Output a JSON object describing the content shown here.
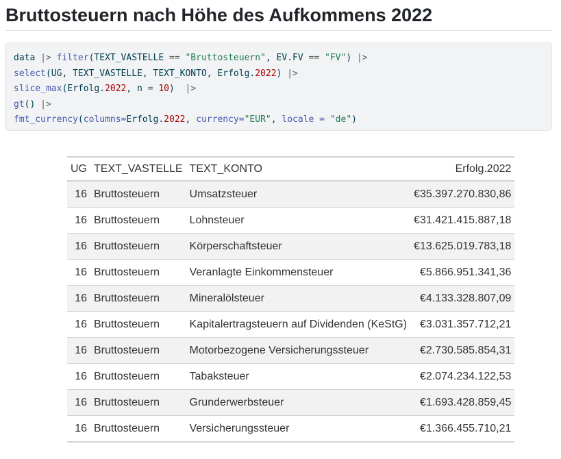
{
  "page": {
    "title": "Bruttosteuern nach Höhe des Aufkommens 2022"
  },
  "code": {
    "lines": [
      [
        {
          "t": "data ",
          "c": "plain"
        },
        {
          "t": "|>",
          "c": "op"
        },
        {
          "t": " ",
          "c": "plain"
        },
        {
          "t": "filter",
          "c": "fn"
        },
        {
          "t": "(TEXT_VASTELLE ",
          "c": "plain"
        },
        {
          "t": "==",
          "c": "op"
        },
        {
          "t": " ",
          "c": "plain"
        },
        {
          "t": "\"Bruttosteuern\"",
          "c": "str"
        },
        {
          "t": ", EV.FV ",
          "c": "plain"
        },
        {
          "t": "==",
          "c": "op"
        },
        {
          "t": " ",
          "c": "plain"
        },
        {
          "t": "\"FV\"",
          "c": "str"
        },
        {
          "t": ") ",
          "c": "plain"
        },
        {
          "t": "|>",
          "c": "op"
        }
      ],
      [
        {
          "t": "select",
          "c": "fn"
        },
        {
          "t": "(UG, TEXT_VASTELLE, TEXT_KONTO, Erfolg.",
          "c": "plain"
        },
        {
          "t": "2022",
          "c": "num"
        },
        {
          "t": ") ",
          "c": "plain"
        },
        {
          "t": "|>",
          "c": "op"
        }
      ],
      [
        {
          "t": "slice_max",
          "c": "fn"
        },
        {
          "t": "(Erfolg.",
          "c": "plain"
        },
        {
          "t": "2022",
          "c": "num"
        },
        {
          "t": ", n ",
          "c": "plain"
        },
        {
          "t": "=",
          "c": "op"
        },
        {
          "t": " ",
          "c": "plain"
        },
        {
          "t": "10",
          "c": "num"
        },
        {
          "t": ")  ",
          "c": "plain"
        },
        {
          "t": "|>",
          "c": "op"
        }
      ],
      [
        {
          "t": "gt",
          "c": "fn"
        },
        {
          "t": "() ",
          "c": "plain"
        },
        {
          "t": "|>",
          "c": "op"
        }
      ],
      [
        {
          "t": "fmt_currency",
          "c": "fn"
        },
        {
          "t": "(",
          "c": "plain"
        },
        {
          "t": "columns=",
          "c": "fn"
        },
        {
          "t": "Erfolg.",
          "c": "plain"
        },
        {
          "t": "2022",
          "c": "num"
        },
        {
          "t": ", ",
          "c": "plain"
        },
        {
          "t": "currency=",
          "c": "fn"
        },
        {
          "t": "\"EUR\"",
          "c": "str"
        },
        {
          "t": ", ",
          "c": "plain"
        },
        {
          "t": "locale =",
          "c": "fn"
        },
        {
          "t": " ",
          "c": "plain"
        },
        {
          "t": "\"de\"",
          "c": "str"
        },
        {
          "t": ")",
          "c": "plain"
        }
      ]
    ]
  },
  "table": {
    "headers": {
      "ug": "UG",
      "vastelle": "TEXT_VASTELLE",
      "konto": "TEXT_KONTO",
      "erfolg": "Erfolg.2022"
    },
    "rows": [
      {
        "ug": "16",
        "vastelle": "Bruttosteuern",
        "konto": "Umsatzsteuer",
        "erfolg": "€35.397.270.830,86"
      },
      {
        "ug": "16",
        "vastelle": "Bruttosteuern",
        "konto": "Lohnsteuer",
        "erfolg": "€31.421.415.887,18"
      },
      {
        "ug": "16",
        "vastelle": "Bruttosteuern",
        "konto": "Körperschaftsteuer",
        "erfolg": "€13.625.019.783,18"
      },
      {
        "ug": "16",
        "vastelle": "Bruttosteuern",
        "konto": "Veranlagte Einkommensteuer",
        "erfolg": "€5.866.951.341,36"
      },
      {
        "ug": "16",
        "vastelle": "Bruttosteuern",
        "konto": "Mineralölsteuer",
        "erfolg": "€4.133.328.807,09"
      },
      {
        "ug": "16",
        "vastelle": "Bruttosteuern",
        "konto": "Kapitalertragsteuern auf Dividenden (KeStG)",
        "erfolg": "€3.031.357.712,21"
      },
      {
        "ug": "16",
        "vastelle": "Bruttosteuern",
        "konto": "Motorbezogene Versicherungssteuer",
        "erfolg": "€2.730.585.854,31"
      },
      {
        "ug": "16",
        "vastelle": "Bruttosteuern",
        "konto": "Tabaksteuer",
        "erfolg": "€2.074.234.122,53"
      },
      {
        "ug": "16",
        "vastelle": "Bruttosteuern",
        "konto": "Grunderwerbsteuer",
        "erfolg": "€1.693.428.859,45"
      },
      {
        "ug": "16",
        "vastelle": "Bruttosteuern",
        "konto": "Versicherungssteuer",
        "erfolg": "€1.366.455.710,21"
      }
    ]
  }
}
